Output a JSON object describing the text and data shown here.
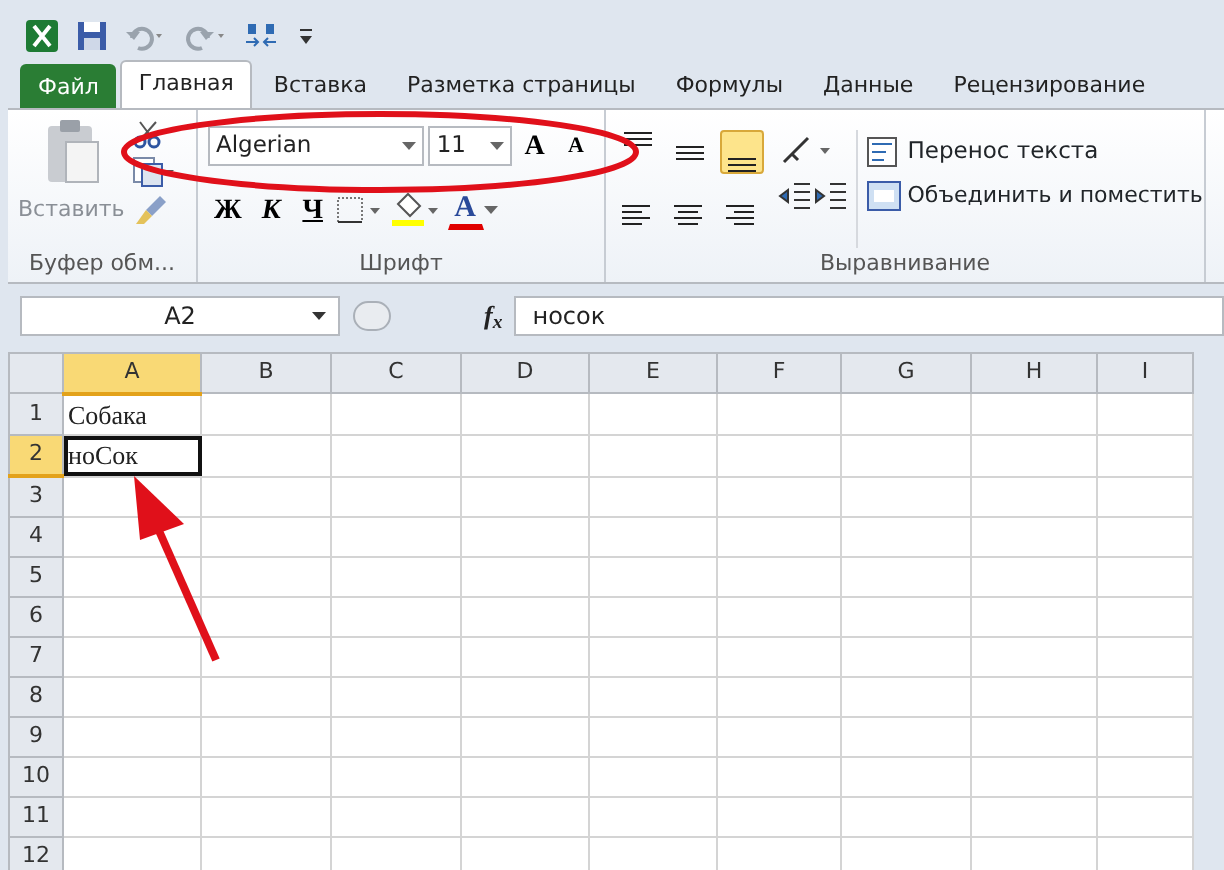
{
  "tabs": [
    {
      "label": "Файл",
      "kind": "file",
      "selected": false
    },
    {
      "label": "Главная",
      "kind": "tab",
      "selected": true
    },
    {
      "label": "Вставка",
      "kind": "tab",
      "selected": false
    },
    {
      "label": "Разметка страницы",
      "kind": "tab",
      "selected": false
    },
    {
      "label": "Формулы",
      "kind": "tab",
      "selected": false
    },
    {
      "label": "Данные",
      "kind": "tab",
      "selected": false
    },
    {
      "label": "Рецензирование",
      "kind": "tab",
      "selected": false
    }
  ],
  "ribbon": {
    "clipboard": {
      "paste_label": "Вставить",
      "group_label": "Буфер обм..."
    },
    "font": {
      "font_name": "Algerian",
      "font_size": "11",
      "grow_glyph": "A",
      "shrink_glyph": "A",
      "bold_label": "Ж",
      "italic_label": "К",
      "underline_label": "Ч",
      "font_color_glyph": "A",
      "group_label": "Шрифт"
    },
    "alignment": {
      "vertical_align": [
        {
          "selected": false
        },
        {
          "selected": false
        },
        {
          "selected": true
        }
      ],
      "wrap_label": "Перенос текста",
      "merge_label": "Объединить и поместить",
      "group_label": "Выравнивание"
    }
  },
  "formula_bar": {
    "name_box": "A2",
    "fx_label": "f$_{x}$",
    "formula": "носок"
  },
  "sheet": {
    "columns": [
      {
        "label": "A",
        "selected": true
      },
      {
        "label": "B",
        "selected": false
      },
      {
        "label": "C",
        "selected": false
      },
      {
        "label": "D",
        "selected": false
      },
      {
        "label": "E",
        "selected": false
      },
      {
        "label": "F",
        "selected": false
      },
      {
        "label": "G",
        "selected": false
      },
      {
        "label": "H",
        "selected": false
      },
      {
        "label": "I",
        "selected": false
      }
    ],
    "rows": [
      {
        "label": "1",
        "selected": false,
        "cells": [
          {
            "text": "Собака",
            "active": false
          }
        ]
      },
      {
        "label": "2",
        "selected": true,
        "cells": [
          {
            "text": "ноСок",
            "active": true
          }
        ]
      },
      {
        "label": "3",
        "selected": false
      },
      {
        "label": "4",
        "selected": false
      },
      {
        "label": "5",
        "selected": false
      },
      {
        "label": "6",
        "selected": false
      },
      {
        "label": "7",
        "selected": false
      },
      {
        "label": "8",
        "selected": false
      },
      {
        "label": "9",
        "selected": false
      },
      {
        "label": "10",
        "selected": false
      },
      {
        "label": "11",
        "selected": false
      },
      {
        "label": "12",
        "selected": false
      }
    ]
  }
}
